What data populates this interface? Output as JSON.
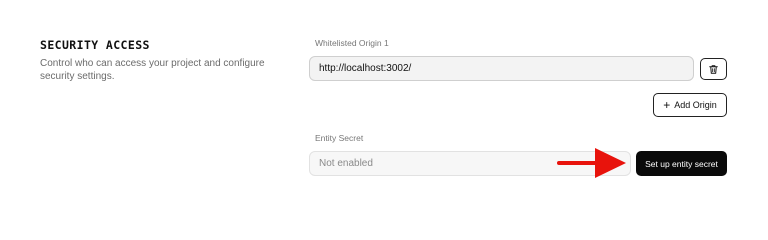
{
  "section": {
    "title": "SECURITY ACCESS",
    "description": "Control who can access your project and configure security settings."
  },
  "origins": {
    "field_label": "Whitelisted Origin 1",
    "value": "http://localhost:3002/",
    "delete_icon": "trash-icon",
    "add_button_icon": "plus-icon",
    "add_button_label": "Add Origin"
  },
  "entity_secret": {
    "field_label": "Entity Secret",
    "status_value": "Not enabled",
    "setup_button_label": "Set up entity secret",
    "annotation_icon": "arrow-right-icon",
    "annotation_color": "#e8130c"
  },
  "colors": {
    "primary_button": "#0a0a0a",
    "input_background": "#f3f3f3",
    "muted_text": "#6b6b6b"
  }
}
